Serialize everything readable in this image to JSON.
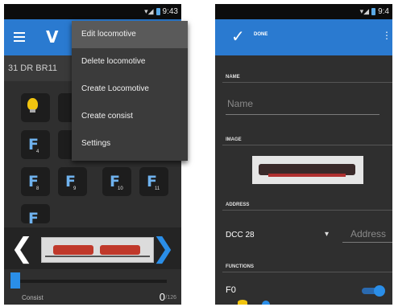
{
  "left": {
    "status_time": "9:43",
    "app_logo": "V",
    "loco_title": "31 DR  BR11",
    "functions": [
      {
        "letter": "F",
        "number": "4"
      },
      {
        "letter": "F",
        "number": "8"
      },
      {
        "letter": "F",
        "number": "9"
      },
      {
        "letter": "F",
        "number": "10"
      },
      {
        "letter": "F",
        "number": "11"
      },
      {
        "letter": "F",
        "number": ""
      }
    ],
    "menu": {
      "items": [
        "Edit locomotive",
        "Delete locomotive",
        "Create Locomotive",
        "Create consist",
        "Settings"
      ],
      "selected": "Edit locomotive"
    },
    "consist_label": "Consist",
    "speed": "0",
    "speed_max": "/126",
    "icons": [
      "menu-icon",
      "bulb-icon",
      "chevron-left-icon",
      "chevron-right-icon"
    ]
  },
  "right": {
    "status_time": "9:4",
    "done_label": "DONE",
    "sections": {
      "name": "NAME",
      "image": "IMAGE",
      "address": "ADDRESS",
      "functions": "FUNCTIONS"
    },
    "name_placeholder": "Name",
    "decoder": "DCC 28",
    "address_placeholder": "Address",
    "function_label": "F0",
    "icons": [
      "check-icon",
      "overflow-icon",
      "dropdown-arrow-icon"
    ]
  },
  "colors": {
    "accent": "#2a7ad0",
    "background": "#2f2f2f",
    "highlight": "#2a8ee8"
  }
}
